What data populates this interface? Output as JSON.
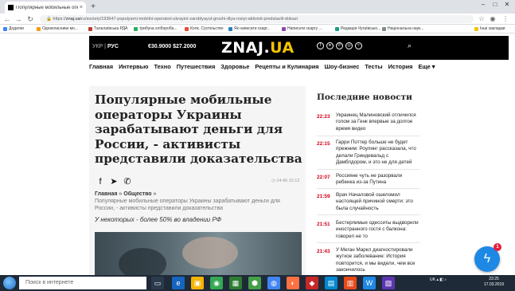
{
  "browser": {
    "tab_title": "Популярные мобильные опера",
    "tab_close": "×",
    "new_tab": "+",
    "url_domain": "znaj.ua",
    "url_path": "/ru/society/193647-populyarni-mobilni-operatori-ukrayini-zaroblyayut-groshi-dlya-rosiyi-aktivisti-predstavili-dokazi",
    "url_prefix": "https://",
    "bookmarks": [
      "Додатки",
      "Однокласники мо...",
      "Талалаївська РДА",
      "трибуна хлібороба...",
      "Колк. Суспільство",
      "Як написати скарг...",
      "Написати скаргу ...",
      "Редакція Чугаївсько...",
      "Національна наук..."
    ],
    "bookmarks_right": "Інші закладки"
  },
  "site": {
    "lang_ukr": "УКР",
    "lang_sep": "|",
    "lang_rus": "РУС",
    "rate": "€30.9000 $27.2000",
    "logo_main": "ZNAJ.",
    "logo_ua": "UA",
    "menu": [
      "Главная",
      "Интервью",
      "Техно",
      "Путешествия",
      "Здоровье",
      "Рецепты и Кулинария",
      "Шоу-бизнес",
      "Тесты",
      "История",
      "Еще ▾"
    ]
  },
  "article": {
    "title": "Популярные мобильные операторы Украины зарабатывают деньги для России, - активисты представили доказательства",
    "time": "14:40 10.12",
    "crumb_home": "Главная",
    "crumb_sep1": "»",
    "crumb_section": "Общество",
    "crumb_sep2": "»",
    "lead": "Популярные мобильные операторы Украины зарабатывают деньги для России, - активисты представили доказательства",
    "subtitle": "У некоторых - более 50% во владении РФ"
  },
  "news": {
    "heading": "Последние новости",
    "items": [
      {
        "time": "22:23",
        "text": "Украинец Малиновский отличился голом за Генк впервые за долгое время видео"
      },
      {
        "time": "22:15",
        "text": "Гарри Поттер больше не будет прежним: Роулинг рассказала, что делали Гриндевальд с Дамблдором, и это не для детей"
      },
      {
        "time": "22:07",
        "text": "Россияне чуть не разорвали ребенка из-за Путина"
      },
      {
        "time": "21:59",
        "text": "Врач Началовой ошеломил настоящей причиной смерти: это была случайность"
      },
      {
        "time": "21:51",
        "text": "Бестерпимые одесситы выдворили иностранного гостя с балкона: говорил не то"
      },
      {
        "time": "21:43",
        "text": "У Меган Маркл диагностировали жуткое заболевание: История повторится, и мы видели, чем все закончилось"
      }
    ]
  },
  "messenger_badge": "1",
  "taskbar": {
    "search_placeholder": "Поиск в интернете",
    "tray_lang": "UK",
    "clock_time": "23:25",
    "clock_date": "17.03.2019"
  },
  "colors": {
    "accent_red": "#d0021b",
    "logo_yellow": "#f5c400",
    "messenger_blue": "#1e88e5"
  }
}
